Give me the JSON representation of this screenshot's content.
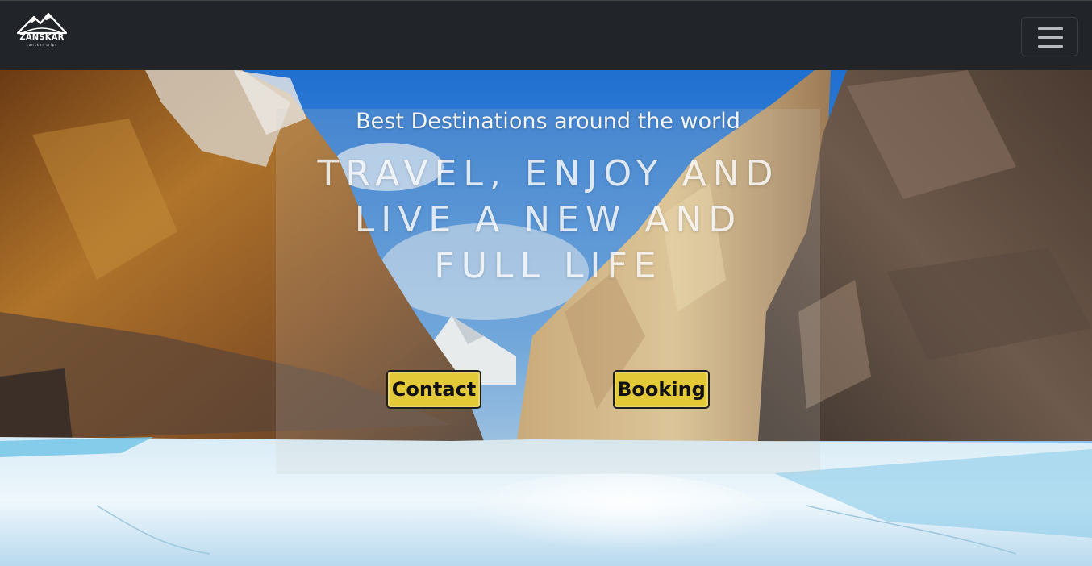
{
  "navbar": {
    "logo_text": "ZANSKAR",
    "logo_subtext": "zanskar trips",
    "menu_toggle": "menu-icon"
  },
  "hero": {
    "subtitle": "Best Destinations around the world",
    "headline_lines": [
      "TRAVEL, ENJOY AND",
      "LIVE A NEW AND",
      "FULL LIFE"
    ],
    "buttons": {
      "contact_label": "Contact",
      "booking_label": "Booking"
    }
  },
  "colors": {
    "navbar_bg": "#212529",
    "button_bg": "#e3c838",
    "sky": "#2a78cc",
    "ice": "#cfe6f3"
  }
}
